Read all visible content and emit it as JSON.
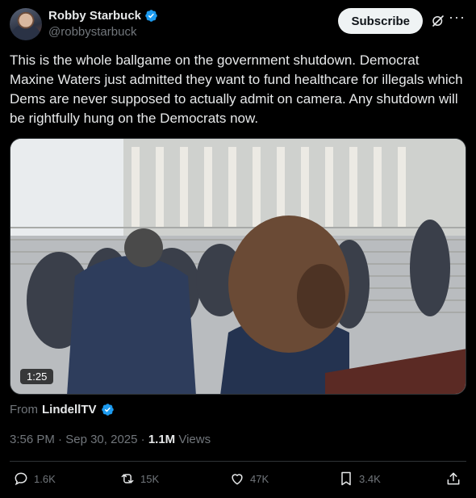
{
  "author": {
    "name": "Robby Starbuck",
    "handle": "@robbystarbuck",
    "verified_color": "#1d9bf0"
  },
  "header": {
    "subscribe_label": "Subscribe",
    "grok_icon": "grok-icon",
    "more_icon": "more-icon"
  },
  "tweet": {
    "text": "This is the whole ballgame on the government shutdown. Democrat Maxine Waters just admitted they want to fund healthcare for illegals which Dems are never supposed to actually admit on camera. Any shutdown will be rightfully hung on the Democrats now."
  },
  "media": {
    "duration": "1:25"
  },
  "source": {
    "prefix": "From",
    "name": "LindellTV"
  },
  "meta": {
    "time": "3:56 PM",
    "date": "Sep 30, 2025",
    "views_count": "1.1M",
    "views_label": "Views"
  },
  "actions": {
    "replies": "1.6K",
    "reposts": "15K",
    "likes": "47K",
    "bookmarks": "3.4K"
  },
  "colors": {
    "background": "#000000",
    "text": "#e7e9ea",
    "muted": "#71767b",
    "accent": "#1d9bf0"
  }
}
